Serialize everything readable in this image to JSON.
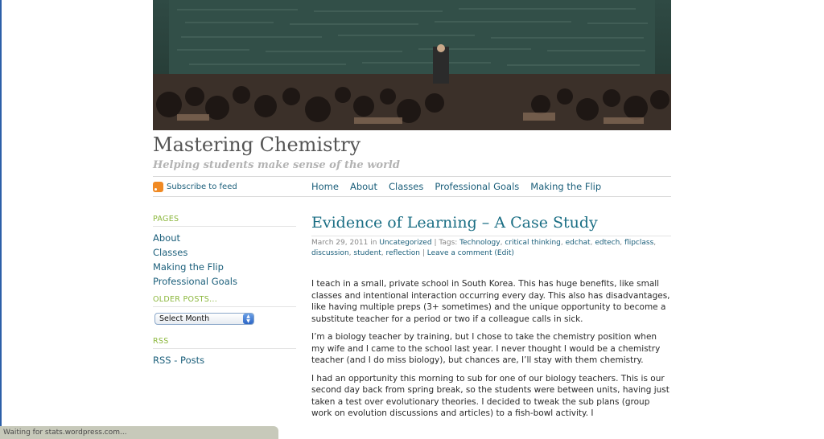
{
  "site": {
    "title": "Mastering Chemistry",
    "tagline": "Helping students make sense of the world"
  },
  "feed": {
    "label": "Subscribe to feed",
    "icon": "rss-icon"
  },
  "nav": {
    "items": [
      {
        "label": "Home"
      },
      {
        "label": "About"
      },
      {
        "label": "Classes"
      },
      {
        "label": "Professional Goals"
      },
      {
        "label": "Making the Flip"
      }
    ]
  },
  "sidebar": {
    "pages_heading": "PAGES",
    "pages": [
      {
        "label": "About"
      },
      {
        "label": "Classes"
      },
      {
        "label": "Making the Flip"
      },
      {
        "label": "Professional Goals"
      }
    ],
    "older_heading": "OLDER POSTS...",
    "month_select": "Select Month",
    "rss_heading": "RSS",
    "rss_link": "RSS - Posts"
  },
  "post": {
    "title": "Evidence of Learning – A Case Study",
    "date": "March 29, 2011",
    "in_word": "in",
    "category": "Uncategorized",
    "tags_label": "| Tags:",
    "tags": [
      "Technology",
      "critical thinking",
      "edchat",
      "edtech",
      "flipclass",
      "discussion",
      "student",
      "reflection"
    ],
    "leave_comment": "Leave a comment",
    "edit": "(Edit)",
    "paragraphs": [
      "I teach in a small, private school in South Korea.  This has huge benefits, like small classes and intentional interaction occurring every day.  This also has disadvantages, like having multiple preps (3+ sometimes) and the unique opportunity to become a substitute teacher for a period or two if a colleague calls in sick.",
      "I’m a biology teacher by training, but I chose to take the chemistry position when my wife and I came to the school last year.  I never thought I would be a chemistry teacher (and I do miss biology), but chances are, I’ll stay with them chemistry.",
      "I had an opportunity this morning to sub for one of our biology teachers.  This is our second day back from spring break, so the students were between units, having just taken a test over evolutionary theories.  I decided to tweak the sub plans (group work on evolution discussions and articles) to a fish-bowl activity.  I"
    ]
  },
  "status": {
    "text": "Waiting for stats.wordpress.com..."
  },
  "colors": {
    "link": "#1a5e7a",
    "heading_green": "#8bb73c",
    "title_teal": "#1a6e84"
  }
}
